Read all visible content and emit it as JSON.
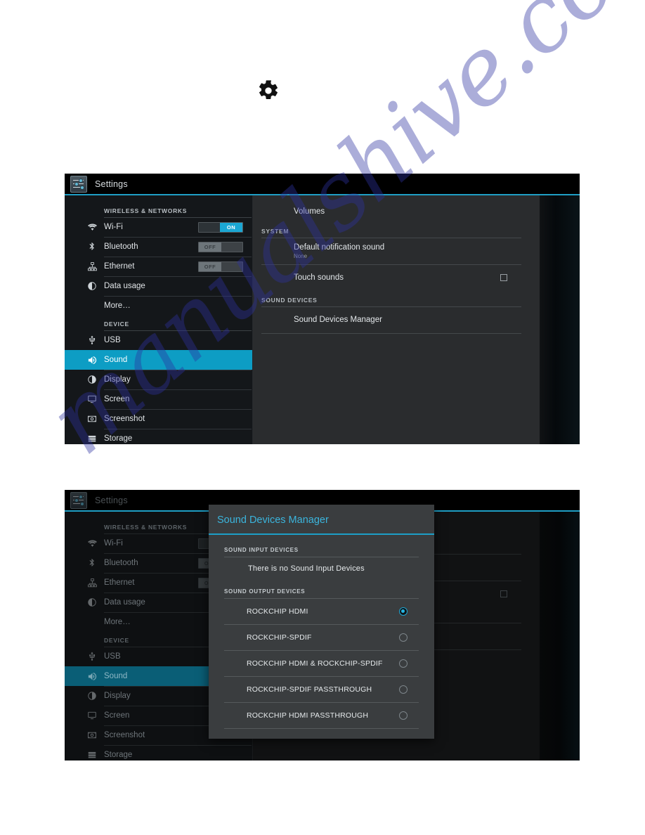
{
  "page": {
    "gear_icon": "gear-icon",
    "watermark_text": "manualshive.com",
    "watermark_color": "#2e32a0"
  },
  "colors": {
    "accent": "#1d9fc7",
    "selected_row": "#0d9dc4",
    "toggle_on": "#1ba7d4",
    "dialog_title": "#3bb5dd",
    "radio_checked": "#25b4e0"
  },
  "screenshot1": {
    "titlebar": {
      "app_icon": "settings-sliders-icon",
      "title": "Settings"
    },
    "sidebar": {
      "sections": [
        {
          "header": "WIRELESS & NETWORKS",
          "items": [
            {
              "label": "Wi-Fi",
              "icon": "wifi-icon",
              "toggle": "ON",
              "toggle_state": "on"
            },
            {
              "label": "Bluetooth",
              "icon": "bluetooth-icon",
              "toggle": "OFF",
              "toggle_state": "off"
            },
            {
              "label": "Ethernet",
              "icon": "ethernet-icon",
              "toggle": "OFF",
              "toggle_state": "off"
            },
            {
              "label": "Data usage",
              "icon": "data-usage-icon",
              "toggle": null,
              "toggle_state": null
            },
            {
              "label": "More…",
              "icon": null,
              "toggle": null,
              "toggle_state": null
            }
          ]
        },
        {
          "header": "DEVICE",
          "items": [
            {
              "label": "USB",
              "icon": "usb-icon",
              "selected": false
            },
            {
              "label": "Sound",
              "icon": "sound-icon",
              "selected": true
            },
            {
              "label": "Display",
              "icon": "display-icon",
              "selected": false
            },
            {
              "label": "Screen",
              "icon": "screen-icon",
              "selected": false
            },
            {
              "label": "Screenshot",
              "icon": "screenshot-icon",
              "selected": false
            },
            {
              "label": "Storage",
              "icon": "storage-icon",
              "selected": false
            }
          ]
        }
      ]
    },
    "content": {
      "rows": [
        {
          "type": "row",
          "title": "Volumes"
        },
        {
          "type": "section",
          "title": "SYSTEM"
        },
        {
          "type": "row",
          "title": "Default notification sound",
          "subtitle": "None"
        },
        {
          "type": "row",
          "title": "Touch sounds",
          "checkbox": true,
          "checked": false
        },
        {
          "type": "section",
          "title": "SOUND DEVICES"
        },
        {
          "type": "row",
          "title": "Sound Devices Manager"
        }
      ]
    }
  },
  "screenshot2": {
    "titlebar": {
      "app_icon": "settings-sliders-icon",
      "title": "Settings"
    },
    "dialog": {
      "title": "Sound Devices Manager",
      "sections": [
        {
          "header": "SOUND INPUT DEVICES",
          "empty_message": "There is no Sound Input Devices",
          "items": []
        },
        {
          "header": "SOUND OUTPUT DEVICES",
          "items": [
            {
              "label": "ROCKCHIP HDMI",
              "selected": true
            },
            {
              "label": "ROCKCHIP-SPDIF",
              "selected": false
            },
            {
              "label": "ROCKCHIP HDMI & ROCKCHIP-SPDIF",
              "selected": false
            },
            {
              "label": "ROCKCHIP-SPDIF PASSTHROUGH",
              "selected": false
            },
            {
              "label": "ROCKCHIP HDMI PASSTHROUGH",
              "selected": false
            }
          ]
        }
      ]
    }
  }
}
